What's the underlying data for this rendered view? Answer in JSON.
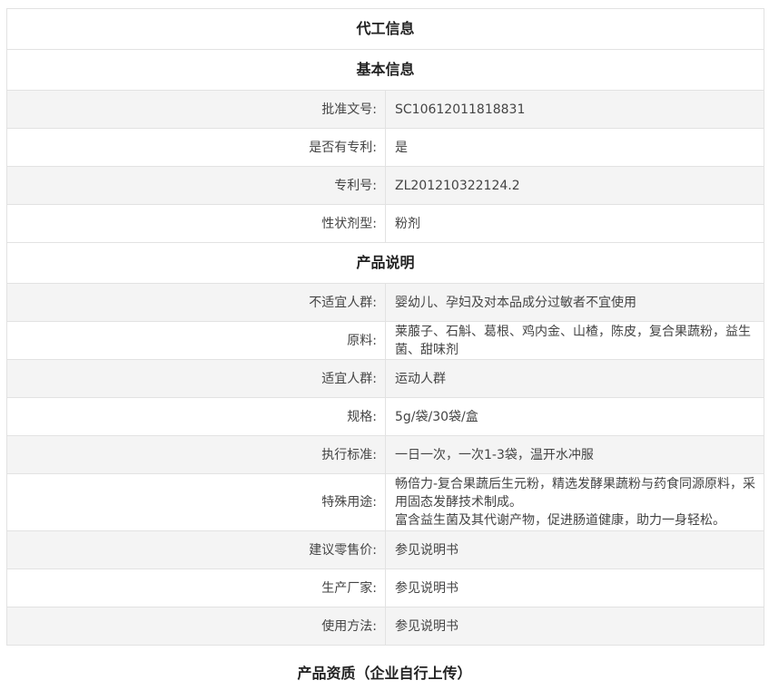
{
  "sections": {
    "oem": {
      "title": "代工信息"
    },
    "basic": {
      "title": "基本信息",
      "rows": [
        {
          "label": "批准文号:",
          "value": "SC10612011818831"
        },
        {
          "label": "是否有专利:",
          "value": "是"
        },
        {
          "label": "专利号:",
          "value": "ZL201210322124.2"
        },
        {
          "label": "性状剂型:",
          "value": "粉剂"
        }
      ]
    },
    "product": {
      "title": "产品说明",
      "rows": [
        {
          "label": "不适宜人群:",
          "value": "婴幼儿、孕妇及对本品成分过敏者不宜使用"
        },
        {
          "label": "原料:",
          "value": "莱菔子、石斛、葛根、鸡内金、山楂，陈皮，复合果蔬粉，益生菌、甜味剂"
        },
        {
          "label": "适宜人群:",
          "value": "运动人群"
        },
        {
          "label": "规格:",
          "value": "5g/袋/30袋/盒"
        },
        {
          "label": "执行标准:",
          "value": "一日一次，一次1-3袋，温开水冲服"
        },
        {
          "label": "特殊用途:",
          "value_line1": "畅倍力-复合果蔬后生元粉，精选发酵果蔬粉与药食同源原料，采用固态发酵技术制成。",
          "value_line2": "富含益生菌及其代谢产物，促进肠道健康，助力一身轻松。"
        },
        {
          "label": "建议零售价:",
          "value": "参见说明书"
        },
        {
          "label": "生产厂家:",
          "value": "参见说明书"
        },
        {
          "label": "使用方法:",
          "value": "参见说明书"
        }
      ]
    }
  },
  "footer": {
    "title": "产品资质（企业自行上传）"
  }
}
